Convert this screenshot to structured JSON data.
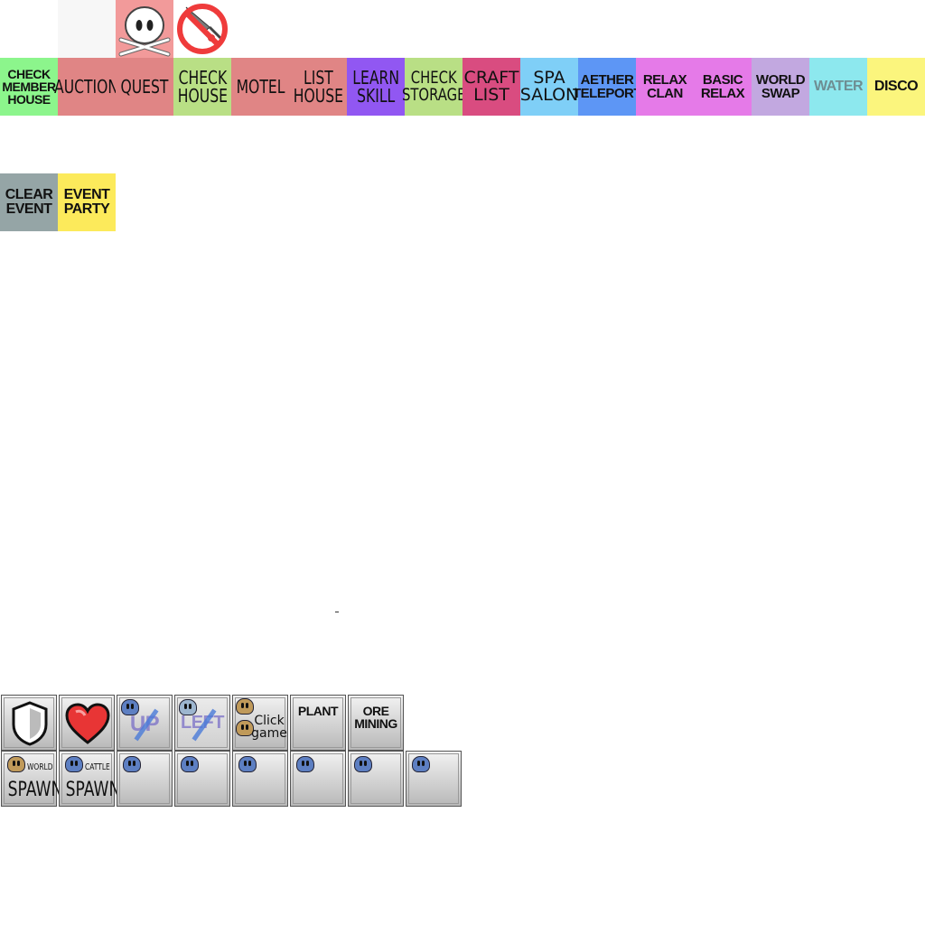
{
  "top_icons": [
    {
      "name": "blank-icon",
      "bg": "#f7f7f7"
    },
    {
      "name": "skull-icon",
      "bg": "#f29a9a"
    },
    {
      "name": "no-weapon-icon",
      "bg": "#ffffff"
    }
  ],
  "menu_row": [
    {
      "label": "CHECK\nMEMBER\nHOUSE",
      "bg": "#8cf58c",
      "style": "bold"
    },
    {
      "label": "AUCTION",
      "bg": "#e08585",
      "style": "thin"
    },
    {
      "label": "QUEST",
      "bg": "#e08585",
      "style": "thin"
    },
    {
      "label": "CHECK\nHOUSE",
      "bg": "#b9df85",
      "style": "thin"
    },
    {
      "label": "MOTEL",
      "bg": "#e08585",
      "style": "thin"
    },
    {
      "label": "LIST\nHOUSE",
      "bg": "#e08585",
      "style": "thin"
    },
    {
      "label": "LEARN\nSKILL",
      "bg": "#9157f2",
      "style": "thin"
    },
    {
      "label": "CHECK\nSTORAGE",
      "bg": "#b9df85",
      "style": "thin"
    },
    {
      "label": "CRAFT\nLIST",
      "bg": "#d94c80",
      "style": "round"
    },
    {
      "label": "SPA\nSALON",
      "bg": "#7fcff7",
      "style": "round"
    },
    {
      "label": "AETHER\nTELEPORT",
      "bg": "#5d96f5",
      "style": "bold"
    },
    {
      "label": "RELAX\nCLAN",
      "bg": "#e57ae8",
      "style": "bold"
    },
    {
      "label": "BASIC\nRELAX",
      "bg": "#e57ae8",
      "style": "bold"
    },
    {
      "label": "WORLD\nSWAP",
      "bg": "#c2a8e0",
      "style": "bold"
    },
    {
      "label": "WATER",
      "bg": "#8de8ee",
      "style": "bold",
      "color": "#6e8e93"
    },
    {
      "label": "DISCO",
      "bg": "#fbf57d",
      "style": "bold"
    }
  ],
  "event_row": [
    {
      "label": "CLEAR\nEVENT",
      "bg": "#95a5a6"
    },
    {
      "label": "EVENT\nPARTY",
      "bg": "#fcea5b"
    }
  ],
  "dash_text": "-",
  "grid_row1": [
    {
      "name": "shield-button",
      "icon": "shield-icon"
    },
    {
      "name": "heart-button",
      "icon": "heart-icon"
    },
    {
      "name": "up-button",
      "icon": "up-icon",
      "text": "UP"
    },
    {
      "name": "left-button",
      "icon": "left-icon",
      "text": "LEFT"
    },
    {
      "name": "click-game-button",
      "text": "Click\ngame"
    },
    {
      "name": "plant-button",
      "text": "PLANT"
    },
    {
      "name": "ore-mining-button",
      "text": "ORE\nMINING"
    }
  ],
  "grid_row2": [
    {
      "name": "world-spawn-button",
      "small": "WORLD",
      "text": "SPAWN",
      "blob": "#c09a5a"
    },
    {
      "name": "cattle-spawn-button",
      "small": "CATTLE",
      "text": "SPAWN",
      "blob": "#5d7fc2"
    },
    {
      "name": "blue-slot-button-1",
      "blob": "#5d7fc2"
    },
    {
      "name": "blue-slot-button-2",
      "blob": "#5d7fc2"
    },
    {
      "name": "blue-slot-button-3",
      "blob": "#5d7fc2"
    },
    {
      "name": "blue-slot-button-4",
      "blob": "#5d7fc2"
    },
    {
      "name": "blue-slot-button-5",
      "blob": "#5d7fc2"
    },
    {
      "name": "blue-slot-button-6",
      "blob": "#5d7fc2"
    }
  ]
}
